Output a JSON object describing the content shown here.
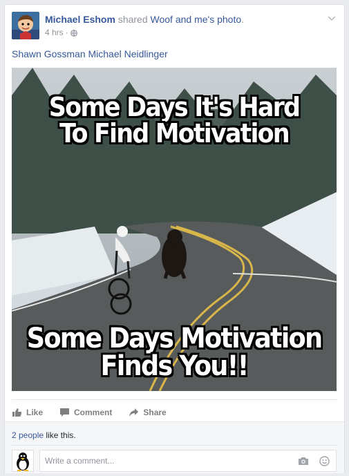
{
  "post": {
    "author": "Michael Eshom",
    "shared_text": "shared",
    "source_link": "Woof and me",
    "source_suffix": "'s",
    "photo_link": "photo",
    "period": ".",
    "time": "4 hrs",
    "meta_sep": "·",
    "tagged": "Shawn Gossman Michael Neidlinger",
    "image": {
      "top_line1": "Some Days It's Hard",
      "top_line2": "To Find Motivation",
      "bottom_line1": "Some Days Motivation",
      "bottom_line2": "Finds You!!"
    }
  },
  "actions": {
    "like": "Like",
    "comment": "Comment",
    "share": "Share"
  },
  "likes": {
    "count_link": "2 people",
    "suffix": " like this."
  },
  "comment": {
    "placeholder": "Write a comment..."
  },
  "icons": {
    "privacy": "globe-icon",
    "menu": "chevron-down-icon",
    "like": "thumbs-up-icon",
    "comment": "speech-bubble-icon",
    "share": "share-arrow-icon",
    "camera": "camera-icon",
    "emoji": "smiley-icon"
  },
  "colors": {
    "link": "#365899",
    "meta": "#90949c",
    "action": "#7f7f7f"
  }
}
